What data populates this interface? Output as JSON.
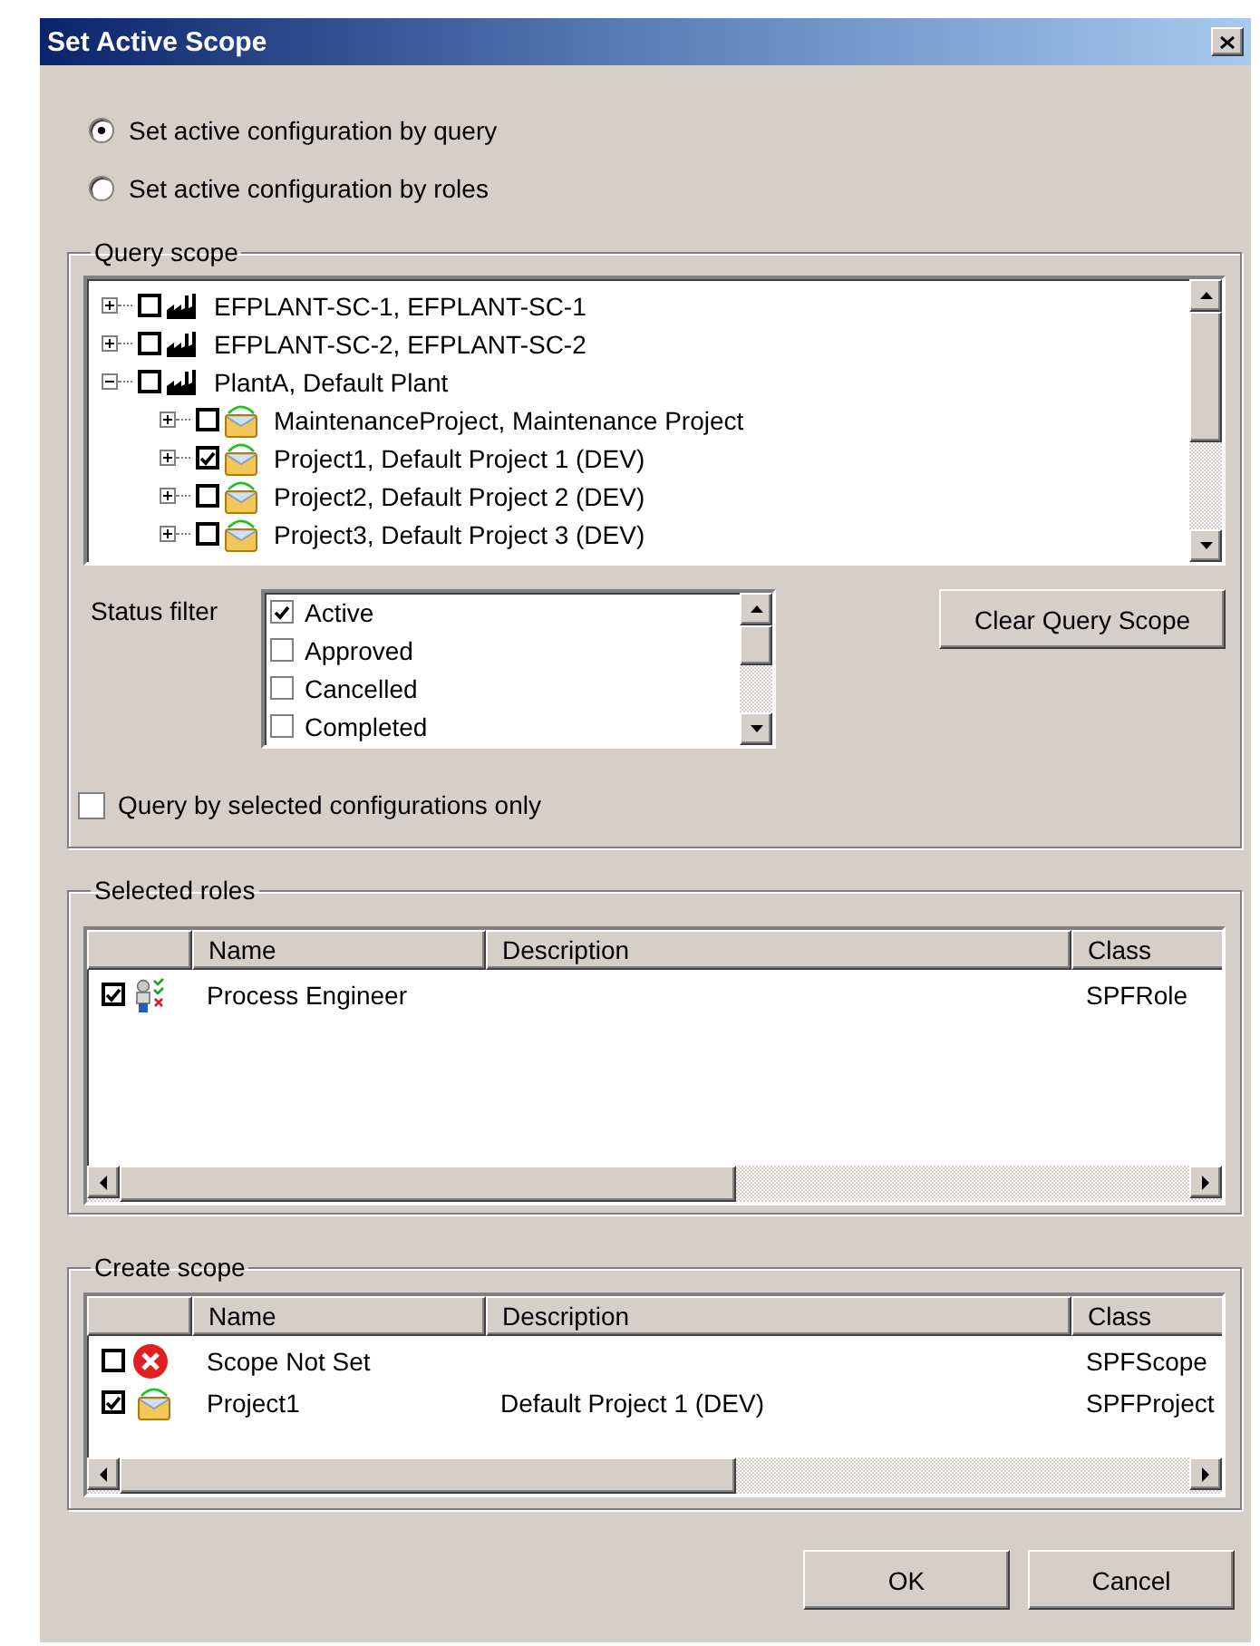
{
  "window": {
    "title": "Set Active Scope"
  },
  "mode_options": [
    {
      "label": "Set active configuration by query",
      "selected": true
    },
    {
      "label": "Set active configuration by roles",
      "selected": false
    }
  ],
  "query_scope": {
    "title": "Query scope",
    "tree": [
      {
        "label": "EFPLANT-SC-1, EFPLANT-SC-1",
        "kind": "plant",
        "checked": false,
        "expanded": false
      },
      {
        "label": "EFPLANT-SC-2, EFPLANT-SC-2",
        "kind": "plant",
        "checked": false,
        "expanded": false
      },
      {
        "label": "PlantA, Default Plant",
        "kind": "plant",
        "checked": false,
        "expanded": true,
        "children": [
          {
            "label": "MaintenanceProject, Maintenance Project",
            "kind": "project",
            "checked": false,
            "expanded": false
          },
          {
            "label": "Project1, Default Project 1 (DEV)",
            "kind": "project",
            "checked": true,
            "expanded": false
          },
          {
            "label": "Project2, Default Project 2 (DEV)",
            "kind": "project",
            "checked": false,
            "expanded": false
          },
          {
            "label": "Project3, Default Project 3 (DEV)",
            "kind": "project",
            "checked": false,
            "expanded": false
          }
        ]
      }
    ],
    "status_filter": {
      "label": "Status filter",
      "items": [
        {
          "label": "Active",
          "checked": true
        },
        {
          "label": "Approved",
          "checked": false
        },
        {
          "label": "Cancelled",
          "checked": false
        },
        {
          "label": "Completed",
          "checked": false
        }
      ]
    },
    "clear_button": "Clear Query Scope",
    "selected_only": {
      "label": "Query by selected configurations only",
      "checked": false
    }
  },
  "selected_roles": {
    "title": "Selected roles",
    "columns": [
      "Name",
      "Description",
      "Class"
    ],
    "rows": [
      {
        "kind": "role",
        "checked": true,
        "name": "Process Engineer",
        "class": "SPFRole"
      }
    ]
  },
  "create_scope": {
    "title": "Create scope",
    "columns": [
      "Name",
      "Description",
      "Class"
    ],
    "rows": [
      {
        "kind": "error",
        "checked": false,
        "name": "Scope Not Set",
        "class": "SPFScope"
      },
      {
        "kind": "project",
        "checked": true,
        "name": "Project1",
        "description": "Default Project 1 (DEV)",
        "class": "SPFProject"
      }
    ]
  },
  "buttons": [
    "OK",
    "Cancel"
  ]
}
